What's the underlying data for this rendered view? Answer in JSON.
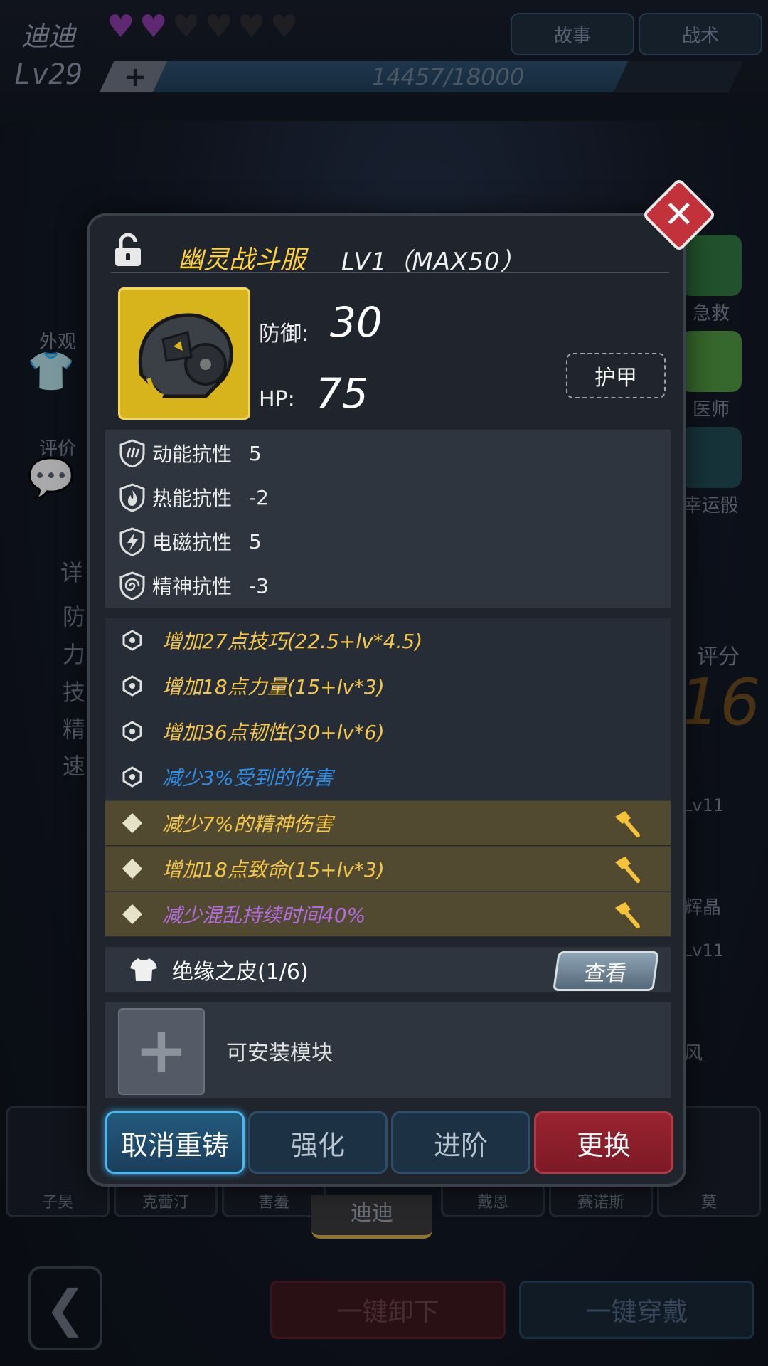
{
  "background": {
    "character_name": "迪迪",
    "hearts": [
      true,
      true,
      false,
      false,
      false,
      false
    ],
    "top_buttons": [
      "故事",
      "战术"
    ],
    "level": "Lv29",
    "plus": "+",
    "xp_text": "14457/18000",
    "xp_fraction": 0.8,
    "left_menu": {
      "appearance": "外观",
      "review": "评价",
      "detail_chars": [
        "详",
        "防",
        "力",
        "技",
        "精",
        "速"
      ]
    },
    "right_menu": [
      "急救",
      "医师",
      "幸运骰"
    ],
    "score_label": "评分",
    "score_value": "16",
    "right_cards": [
      "Lv11",
      "辉晶",
      "Lv11",
      "风"
    ],
    "roster": [
      "子昊",
      "克蕾汀",
      "害羞",
      "迪迪",
      "戴恩",
      "赛诺斯",
      "莫"
    ],
    "selected_tab": "迪迪",
    "bottom_buttons": {
      "unequip_all": "一键卸下",
      "equip_all": "一键穿戴"
    }
  },
  "modal": {
    "item_name": "幽灵战斗服",
    "item_level": "LV1（MAX50）",
    "defense_label": "防御:",
    "defense_value": "30",
    "hp_label": "HP:",
    "hp_value": "75",
    "type_tag": "护甲",
    "resistances": [
      {
        "icon": "kinetic-icon",
        "label": "动能抗性",
        "value": "5"
      },
      {
        "icon": "thermal-icon",
        "label": "热能抗性",
        "value": "-2"
      },
      {
        "icon": "electromagnetic-icon",
        "label": "电磁抗性",
        "value": "5"
      },
      {
        "icon": "psychic-icon",
        "label": "精神抗性",
        "value": "-3"
      }
    ],
    "attributes": [
      {
        "text": "增加27点技巧(22.5+lv*4.5)",
        "color": "#f4c64a",
        "bullet": "hex"
      },
      {
        "text": "增加18点力量(15+lv*3)",
        "color": "#f4c64a",
        "bullet": "hex"
      },
      {
        "text": "增加36点韧性(30+lv*6)",
        "color": "#f4c64a",
        "bullet": "hex"
      },
      {
        "text": "减少3%受到的伤害",
        "color": "#2f8ee8",
        "bullet": "hex"
      },
      {
        "text": "减少7%的精神伤害",
        "color": "#f4c64a",
        "bullet": "diamond",
        "hammer": true
      },
      {
        "text": "增加18点致命(15+lv*3)",
        "color": "#f4c64a",
        "bullet": "diamond",
        "hammer": true
      },
      {
        "text": "减少混乱持续时间40%",
        "color": "#b46be0",
        "bullet": "diamond",
        "hammer": true
      }
    ],
    "set_name": "绝缘之皮(1/6)",
    "view_label": "查看",
    "module_text": "可安装模块",
    "buttons": {
      "cancel_reforge": "取消重铸",
      "enhance": "强化",
      "advance": "进阶",
      "replace": "更换"
    }
  },
  "colors": {
    "gold": "#ffd23c",
    "blue": "#2f8ee8",
    "purple": "#b46be0",
    "red": "#c3323a"
  }
}
